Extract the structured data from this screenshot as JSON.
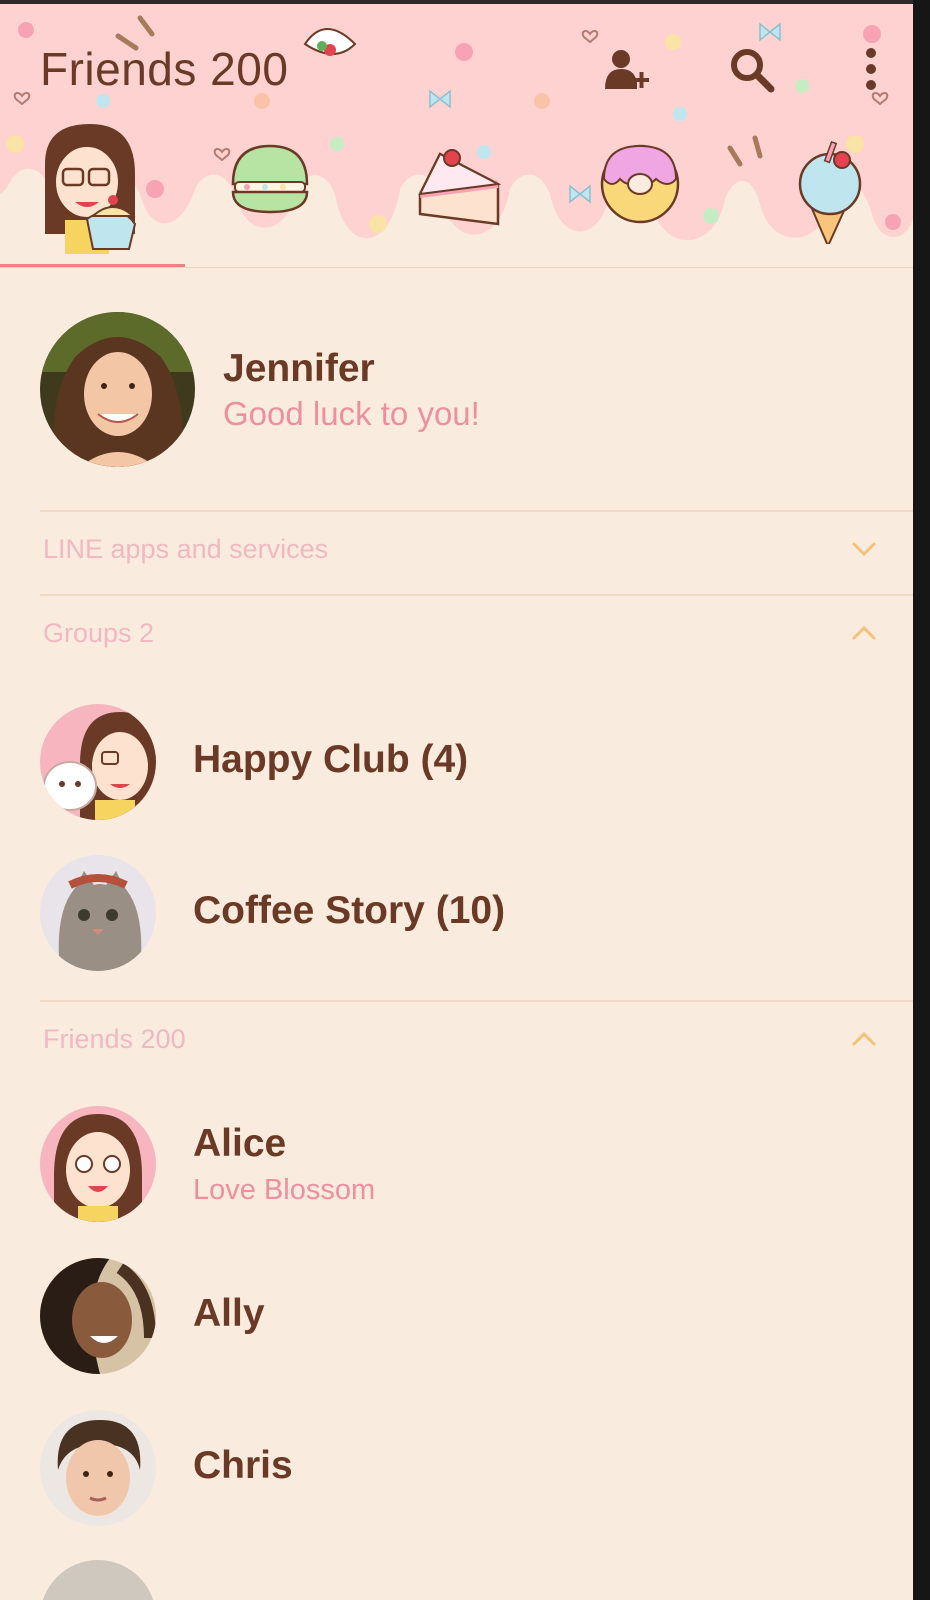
{
  "header": {
    "title": "Friends 200",
    "icons": [
      "add-friend-icon",
      "search-icon",
      "more-vert-icon"
    ],
    "tabs": [
      "tab-friends-girl",
      "tab-macaron",
      "tab-cake",
      "tab-donut",
      "tab-icecream"
    ],
    "selected_tab": 0
  },
  "profile": {
    "name": "Jennifer",
    "status": "Good luck to you!"
  },
  "sections": {
    "services": {
      "label": "LINE apps and services",
      "state": "collapsed"
    },
    "groups": {
      "label": "Groups 2",
      "state": "expanded"
    },
    "friends": {
      "label": "Friends 200",
      "state": "expanded"
    }
  },
  "groups": [
    {
      "name": "Happy Club (4)"
    },
    {
      "name": "Coffee Story (10)"
    }
  ],
  "friends": [
    {
      "name": "Alice",
      "status": "Love Blossom"
    },
    {
      "name": "Ally"
    },
    {
      "name": "Chris"
    }
  ],
  "colors": {
    "background": "#f9ecde",
    "header_pink": "#fdd2d0",
    "text_brown": "#6b3a26",
    "accent_pink": "#ee8fa0",
    "section_label": "#f2b8c2",
    "chevron": "#f5c27a",
    "tab_indicator": "#f07f86"
  }
}
